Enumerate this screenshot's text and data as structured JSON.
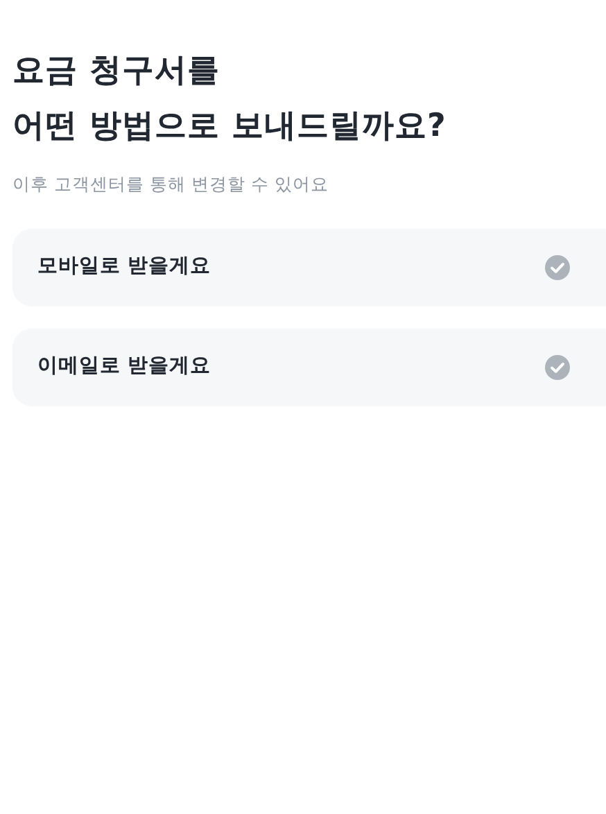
{
  "title_lines": [
    "요금 청구서를",
    "어떤 방법으로 보내드릴까요?"
  ],
  "subtitle": "이후 고객센터를 통해 변경할 수 있어요",
  "options": [
    {
      "label": "모바일로 받을게요",
      "selected": false
    },
    {
      "label": "이메일로 받을게요",
      "selected": false
    }
  ]
}
